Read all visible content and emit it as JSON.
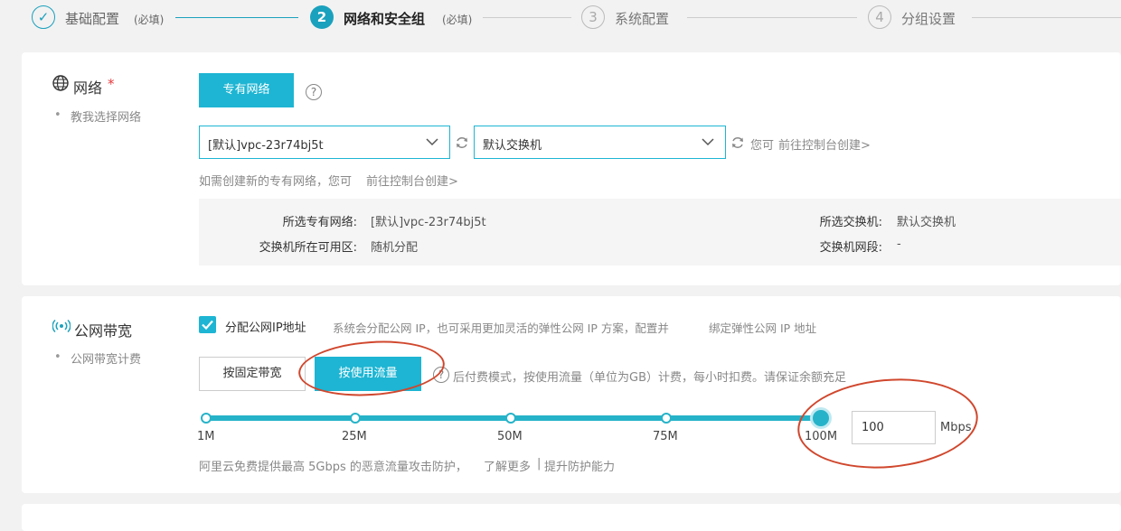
{
  "stepper": {
    "steps": [
      {
        "number": "✓",
        "title": "基础配置",
        "required": "(必填)",
        "state": "done"
      },
      {
        "number": "2",
        "title": "网络和安全组",
        "required": "(必填)",
        "state": "active"
      },
      {
        "number": "3",
        "title": "系统配置",
        "required": "",
        "state": "todo"
      },
      {
        "number": "4",
        "title": "分组设置",
        "required": "",
        "state": "todo"
      }
    ]
  },
  "network": {
    "title": "网络",
    "required_mark": "*",
    "guide_link": "教我选择网络",
    "vpc_button": "专有网络",
    "help_icon": "?",
    "vpc_select_value": "[默认]vpc-23r74bj5t",
    "vswitch_select_value": "默认交换机",
    "you_can": "您可",
    "console_link": "前往控制台创建>",
    "hint_text": "如需创建新的专有网络，您可",
    "hint_link": "前往控制台创建>",
    "summary": {
      "selected_vpc_label": "所选专有网络:",
      "selected_vpc_value": "[默认]vpc-23r74bj5t",
      "zone_label": "交换机所在可用区:",
      "zone_value": "随机分配",
      "selected_vswitch_label": "所选交换机:",
      "selected_vswitch_value": "默认交换机",
      "vswitch_cidr_label": "交换机网段:",
      "vswitch_cidr_value": "-"
    }
  },
  "bandwidth": {
    "title": "公网带宽",
    "billing_link": "公网带宽计费",
    "assign_ip_label": "分配公网IP地址",
    "assign_ip_checked": true,
    "assign_ip_note": "系统会分配公网 IP，也可采用更加灵活的弹性公网 IP 方案，配置并",
    "eip_link": "绑定弹性公网 IP 地址",
    "fixed_button": "按固定带宽",
    "traffic_button": "按使用流量",
    "traffic_note": "后付费模式，按使用流量（单位为GB）计费，每小时扣费。请保证余额充足",
    "slider_labels": [
      "1M",
      "25M",
      "50M",
      "75M",
      "100M"
    ],
    "slider_value_fraction": 1.0,
    "bandwidth_value": "100",
    "unit": "Mbps",
    "ddos_note": "阿里云免费提供最高 5Gbps 的恶意流量攻击防护，",
    "learn_more": "了解更多",
    "separator": "|",
    "upgrade_link": "提升防护能力"
  },
  "colors": {
    "accent": "#1db5d3",
    "annotation_red": "#d0472d"
  }
}
